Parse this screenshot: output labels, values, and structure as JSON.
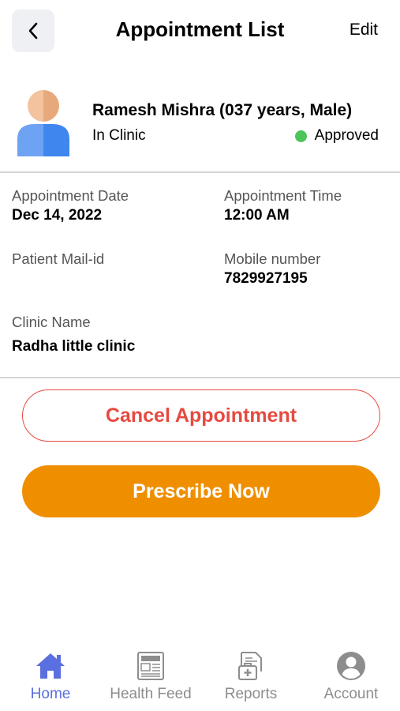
{
  "header": {
    "title": "Appointment List",
    "edit_label": "Edit"
  },
  "patient": {
    "name": "Ramesh Mishra (037 years, Male)",
    "mode": "In Clinic",
    "status": "Approved",
    "status_color": "#4cc45a"
  },
  "details": {
    "appointment_date": {
      "label": "Appointment Date",
      "value": "Dec 14, 2022"
    },
    "appointment_time": {
      "label": "Appointment Time",
      "value": "12:00 AM"
    },
    "patient_mail": {
      "label": "Patient Mail-id",
      "value": ""
    },
    "mobile": {
      "label": "Mobile number",
      "value": "7829927195"
    },
    "clinic": {
      "label": "Clinic Name",
      "value": "Radha little clinic"
    }
  },
  "actions": {
    "cancel_label": "Cancel Appointment",
    "prescribe_label": "Prescribe Now"
  },
  "tabs": [
    {
      "label": "Home",
      "icon": "home-icon",
      "active": true
    },
    {
      "label": "Health Feed",
      "icon": "newspaper-icon",
      "active": false
    },
    {
      "label": "Reports",
      "icon": "medical-report-icon",
      "active": false
    },
    {
      "label": "Account",
      "icon": "account-icon",
      "active": false
    }
  ],
  "colors": {
    "accent": "#5a6fe0",
    "cancel": "#e64a40",
    "prescribe": "#ef8f00"
  }
}
